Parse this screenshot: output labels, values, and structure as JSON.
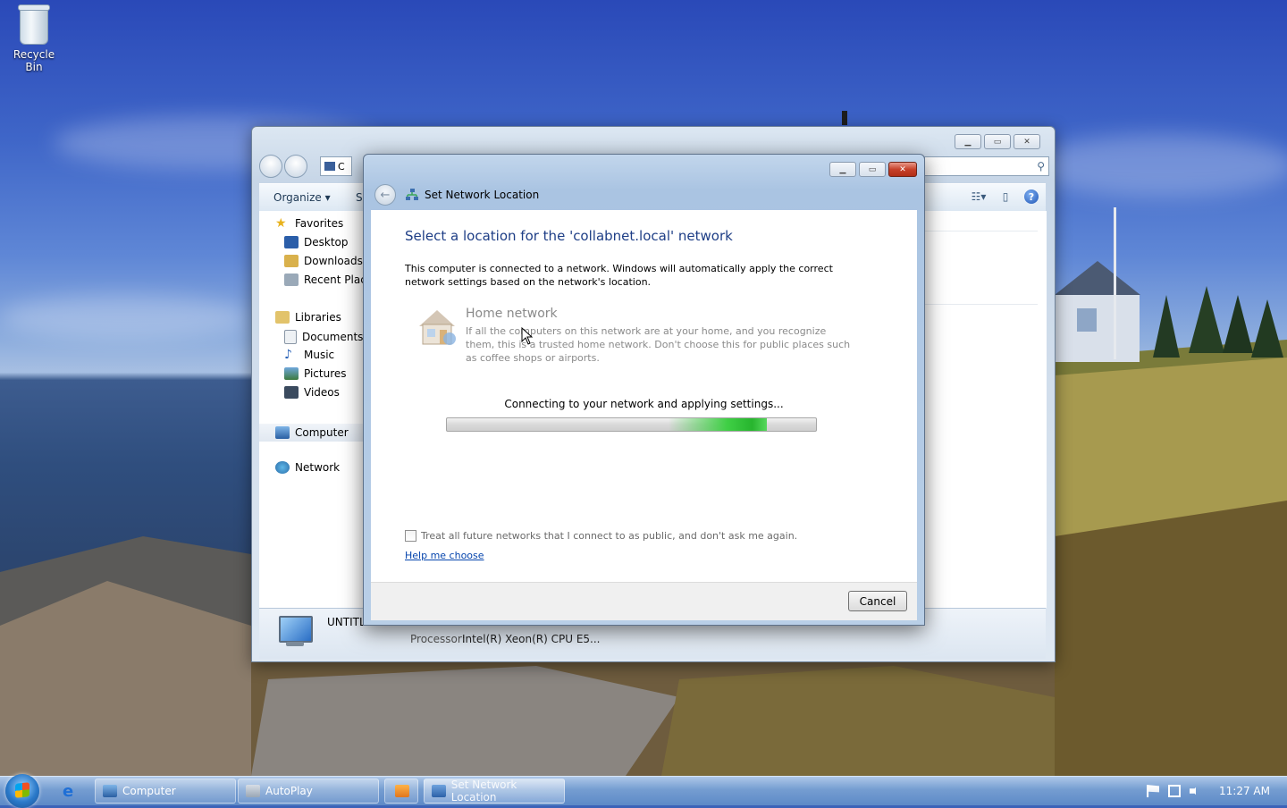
{
  "desktop": {
    "icons": [
      {
        "label": "Recycle Bin",
        "icon": "recycle-bin-icon"
      }
    ]
  },
  "explorer": {
    "address_text": "C",
    "toolbar": {
      "organize": "Organize ▾",
      "system_truncated": "Sy"
    },
    "nav": {
      "favorites": "Favorites",
      "desktop": "Desktop",
      "downloads": "Downloads",
      "recent": "Recent Places",
      "libraries": "Libraries",
      "documents": "Documents",
      "music": "Music",
      "pictures": "Pictures",
      "videos": "Videos",
      "computer": "Computer",
      "network": "Network"
    },
    "details": {
      "name": "UNTITLED",
      "processor_label": "Processor:",
      "processor_value": "Intel(R) Xeon(R) CPU E5..."
    }
  },
  "dialog": {
    "title": "Set Network Location",
    "heading": "Select a location for the 'collabnet.local' network",
    "intro": "This computer is connected to a network. Windows will automatically apply the correct network settings based on the network's location.",
    "option": {
      "title": "Home network",
      "description": "If all the computers on this network are at your home, and you recognize them, this is a trusted home network.  Don't choose this for public places such as coffee shops or airports."
    },
    "status": "Connecting to your network and applying settings...",
    "progress": {
      "state": "indeterminate",
      "glow_position": 0.8
    },
    "checkbox_label": "Treat all future networks that I connect to as public, and don't ask me again.",
    "checkbox_checked": false,
    "help_link": "Help me choose",
    "cancel": "Cancel"
  },
  "taskbar": {
    "buttons": [
      {
        "label": "Computer",
        "active": false
      },
      {
        "label": "AutoPlay",
        "active": false
      },
      {
        "label": "",
        "active": false
      },
      {
        "label": "Set Network Location",
        "active": true
      }
    ],
    "clock": "11:27 AM"
  }
}
